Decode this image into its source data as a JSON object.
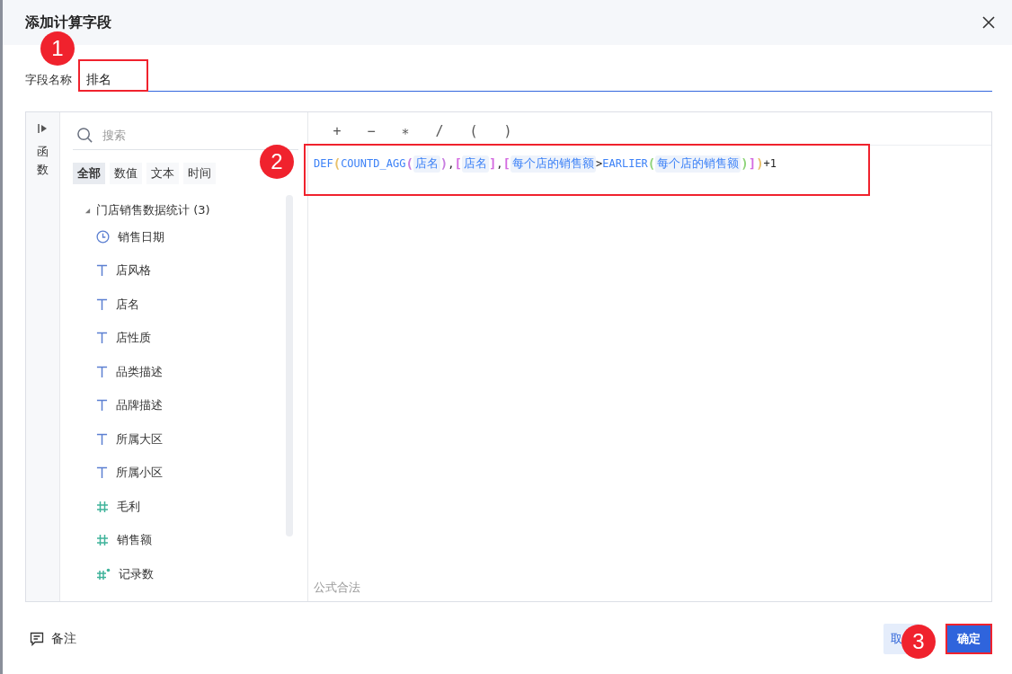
{
  "dialog": {
    "title": "添加计算字段"
  },
  "name_field": {
    "label": "字段名称",
    "value": "排名"
  },
  "functions_tab": {
    "label": "函数"
  },
  "search": {
    "placeholder": "搜索"
  },
  "filters": [
    {
      "label": "全部",
      "selected": true
    },
    {
      "label": "数值",
      "selected": false
    },
    {
      "label": "文本",
      "selected": false
    },
    {
      "label": "时间",
      "selected": false
    }
  ],
  "tree": {
    "label": "门店销售数据统计 (3)",
    "expanded": true,
    "children": [
      {
        "label": "销售日期",
        "kind": "date"
      },
      {
        "label": "店风格",
        "kind": "text"
      },
      {
        "label": "店名",
        "kind": "text"
      },
      {
        "label": "店性质",
        "kind": "text"
      },
      {
        "label": "品类描述",
        "kind": "text"
      },
      {
        "label": "品牌描述",
        "kind": "text"
      },
      {
        "label": "所属大区",
        "kind": "text"
      },
      {
        "label": "所属小区",
        "kind": "text"
      },
      {
        "label": "毛利",
        "kind": "number"
      },
      {
        "label": "销售额",
        "kind": "number"
      },
      {
        "label": "记录数",
        "kind": "count"
      }
    ]
  },
  "operators": [
    "+",
    "−",
    "∗",
    "/",
    "(",
    ")"
  ],
  "formula": [
    {
      "text": "DEF",
      "kind": "function"
    },
    {
      "text": "(",
      "kind": "bracket",
      "color": "#e8c06a"
    },
    {
      "text": "COUNTD_AGG",
      "kind": "function"
    },
    {
      "text": "(",
      "kind": "bracket",
      "color": "#c77de0"
    },
    {
      "text": "店名",
      "kind": "field"
    },
    {
      "text": ")",
      "kind": "bracket",
      "color": "#c77de0"
    },
    {
      "text": ",",
      "kind": "plain"
    },
    {
      "text": "[",
      "kind": "bracket",
      "color": "#d46be0"
    },
    {
      "text": "店名",
      "kind": "field"
    },
    {
      "text": "]",
      "kind": "bracket",
      "color": "#d46be0"
    },
    {
      "text": ",",
      "kind": "plain"
    },
    {
      "text": "[",
      "kind": "bracket",
      "color": "#d46be0"
    },
    {
      "text": "每个店的销售额",
      "kind": "field"
    },
    {
      "text": ">",
      "kind": "plain"
    },
    {
      "text": "EARLIER",
      "kind": "function"
    },
    {
      "text": "(",
      "kind": "bracket",
      "color": "#8fd47a"
    },
    {
      "text": "每个店的销售额",
      "kind": "field"
    },
    {
      "text": ")",
      "kind": "bracket",
      "color": "#8fd47a"
    },
    {
      "text": "]",
      "kind": "bracket",
      "color": "#d46be0"
    },
    {
      "text": ")",
      "kind": "bracket",
      "color": "#e8c06a"
    },
    {
      "text": "+1",
      "kind": "plain"
    }
  ],
  "status": "公式合法",
  "footer": {
    "note": "备注",
    "cancel": "取",
    "confirm": "确定"
  },
  "annotations": [
    "1",
    "2",
    "3"
  ]
}
